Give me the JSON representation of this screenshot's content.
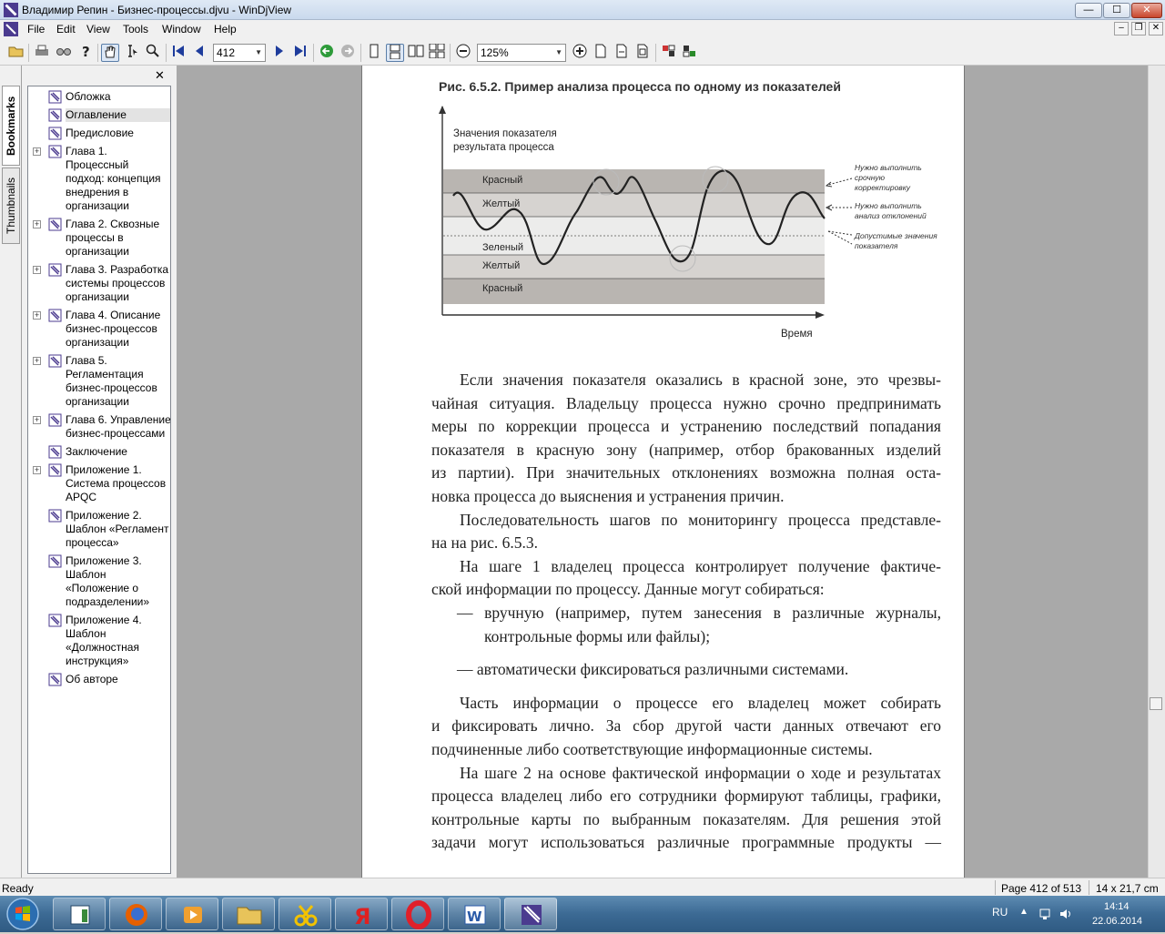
{
  "window": {
    "title": "Владимир Репин - Бизнес-процессы.djvu - WinDjView",
    "buttons": {
      "minimize": "—",
      "maximize": "☐",
      "close": "✕"
    },
    "mdi_buttons": {
      "minimize": "–",
      "restore": "❐",
      "close": "✕"
    }
  },
  "menu": [
    "File",
    "Edit",
    "View",
    "Tools",
    "Window",
    "Help"
  ],
  "toolbar": {
    "page_number": "412",
    "zoom": "125%"
  },
  "sidebar": {
    "tabs": [
      "Bookmarks",
      "Thumbnails"
    ],
    "active_tab": "Bookmarks",
    "close_label": "✕",
    "bookmarks": [
      {
        "label": "Обложка",
        "expandable": false
      },
      {
        "label": "Оглавление",
        "expandable": false,
        "selected": true
      },
      {
        "label": "Предисловие",
        "expandable": false
      },
      {
        "label": "Глава 1.\nПроцессный\nподход: концепция\nвнедрения в\nорганизации",
        "expandable": true
      },
      {
        "label": "Глава 2. Сквозные\nпроцессы в\nорганизации",
        "expandable": true
      },
      {
        "label": "Глава 3. Разработка\nсистемы процессов\nорганизации",
        "expandable": true
      },
      {
        "label": "Глава 4. Описание\nбизнес-процессов\nорганизации",
        "expandable": true
      },
      {
        "label": "Глава 5.\nРегламентация\nбизнес-процессов\nорганизации",
        "expandable": true
      },
      {
        "label": "Глава 6. Управление\nбизнес-процессами",
        "expandable": true
      },
      {
        "label": "Заключение",
        "expandable": false
      },
      {
        "label": "Приложение 1.\nСистема процессов\nAPQC",
        "expandable": true
      },
      {
        "label": "Приложение 2.\nШаблон «Регламент\nпроцесса»",
        "expandable": false
      },
      {
        "label": "Приложение 3.\nШаблон\n«Положение о\nподразделении»",
        "expandable": false
      },
      {
        "label": "Приложение 4.\nШаблон\n«Должностная\nинструкция»",
        "expandable": false
      },
      {
        "label": "Об авторе",
        "expandable": false
      }
    ]
  },
  "document": {
    "figure_caption": "Рис. 6.5.2. Пример анализа процесса по одному из показателей",
    "figure": {
      "y_label": [
        "Значения показателя",
        "результата процесса"
      ],
      "x_label": "Время",
      "zones": [
        "Красный",
        "Желтый",
        "Зеленый",
        "Желтый",
        "Красный"
      ],
      "annotations": [
        [
          "Нужно выполнить",
          "срочную",
          "корректировку"
        ],
        [
          "Нужно выполнить",
          "анализ отклонений"
        ],
        [
          "Допустимые значения",
          "показателя"
        ]
      ],
      "zone_colors": {
        "red": "#b9b5b1",
        "yellow": "#d6d3d0",
        "green": "#ececeb"
      }
    },
    "lines": [
      {
        "text": "Если значения показателя оказались в красной зоне, это чрезвы-",
        "indent": true
      },
      {
        "text": "чайная ситуация. Владельцу процесса нужно срочно предпринимать"
      },
      {
        "text": "меры по коррекции процесса и устранению последствий попадания"
      },
      {
        "text": "показателя в красную зону (например, отбор бракованных изделий"
      },
      {
        "text": "из партии). При значительных отклонениях возможна полная оста-"
      },
      {
        "text": "новка процесса до выяснения и устранения причин.",
        "last": true
      },
      {
        "text": "Последовательность шагов по мониторингу процесса представле-",
        "indent": true
      },
      {
        "text": "на на рис. 6.5.3.",
        "last": true
      },
      {
        "text": "На шаге 1 владелец процесса контролирует получение фактиче-",
        "indent": true
      },
      {
        "text": "ской информации по процессу. Данные могут собираться:",
        "last": true
      },
      {
        "text": "— вручную (например, путем занесения в различные журналы,",
        "bullet": true
      },
      {
        "text": "контрольные формы или файлы);",
        "bullet_cont": true,
        "last": true
      },
      {
        "text": "— автоматически фиксироваться различными системами.",
        "bullet": true,
        "last": true,
        "gap": true
      },
      {
        "text": "Часть информации о процессе его владелец может собирать",
        "indent": true,
        "gap": true
      },
      {
        "text": "и фиксировать лично. За сбор другой части данных отвечают его"
      },
      {
        "text": "подчиненные либо соответствующие информационные системы.",
        "last": true
      },
      {
        "text": "На шаге 2 на основе фактической информации о ходе и результатах",
        "indent": true
      },
      {
        "text": "процесса владелец либо его сотрудники формируют таблицы, графики,"
      },
      {
        "text": "контрольные карты по выбранным показателям. Для решения этой"
      },
      {
        "text": "задачи могут использоваться различные программные продукты —"
      }
    ]
  },
  "status": {
    "left": "Ready",
    "page": "Page 412 of 513",
    "size": "14 x 21,7 cm"
  },
  "taskbar": {
    "apps": [
      "explorer",
      "firefox",
      "media-player",
      "folder",
      "scissors",
      "yandex",
      "opera",
      "word",
      "windjview"
    ],
    "lang": "RU",
    "time": "14:14",
    "date": "22.06.2014"
  }
}
